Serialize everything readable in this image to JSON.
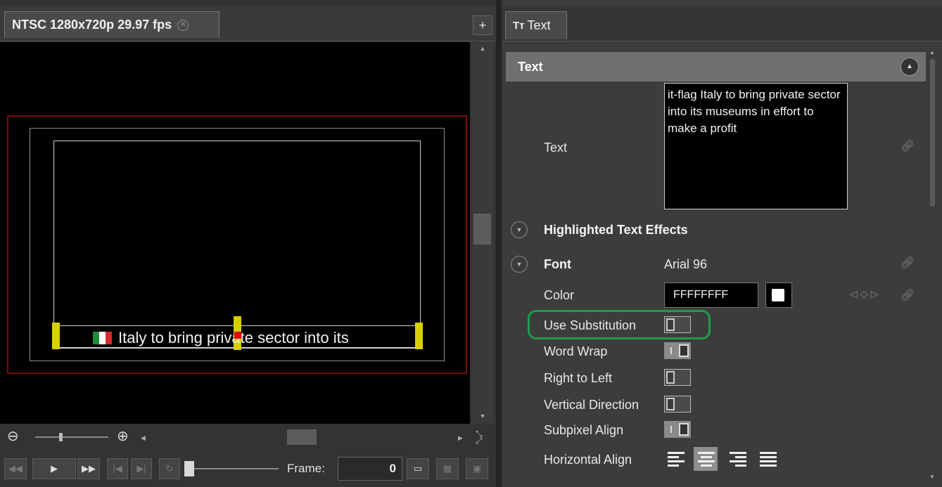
{
  "left_panel": {
    "tab_label": "NTSC 1280x720p 29.97 fps",
    "add_tab_label": "+",
    "canvas_text": "Italy to bring private sector into its",
    "frame_label": "Frame:",
    "frame_value": "0"
  },
  "right_panel": {
    "tab_icon": "Tт",
    "tab_label": "Text",
    "section_title": "Text",
    "text_label": "Text",
    "text_value": "it-flag Italy to bring private sector into its museums in effort to make a profit",
    "highlighted_effects_label": "Highlighted Text Effects",
    "font_label": "Font",
    "font_value": "Arial 96",
    "color_label": "Color",
    "color_value": "FFFFFFFF",
    "toggles": [
      {
        "label": "Use Substitution",
        "state": "off"
      },
      {
        "label": "Word Wrap",
        "state": "on"
      },
      {
        "label": "Right to Left",
        "state": "off"
      },
      {
        "label": "Vertical Direction",
        "state": "off"
      },
      {
        "label": "Subpixel Align",
        "state": "on"
      }
    ],
    "horizontal_align_label": "Horizontal Align",
    "horizontal_align_selected": "center"
  },
  "colors": {
    "highlight_ring": "#1f9b4b",
    "safe_area": "#7a0b0b",
    "handles": "#d6d000"
  },
  "icons": [
    "close-circle-icon",
    "zoom-out-icon",
    "zoom-in-icon",
    "fit-screen-icon",
    "rewind-icon",
    "play-icon",
    "fast-forward-icon",
    "step-back-icon",
    "step-forward-icon",
    "loop-icon",
    "monitor-icon",
    "link-icon",
    "keyframe-icon"
  ]
}
